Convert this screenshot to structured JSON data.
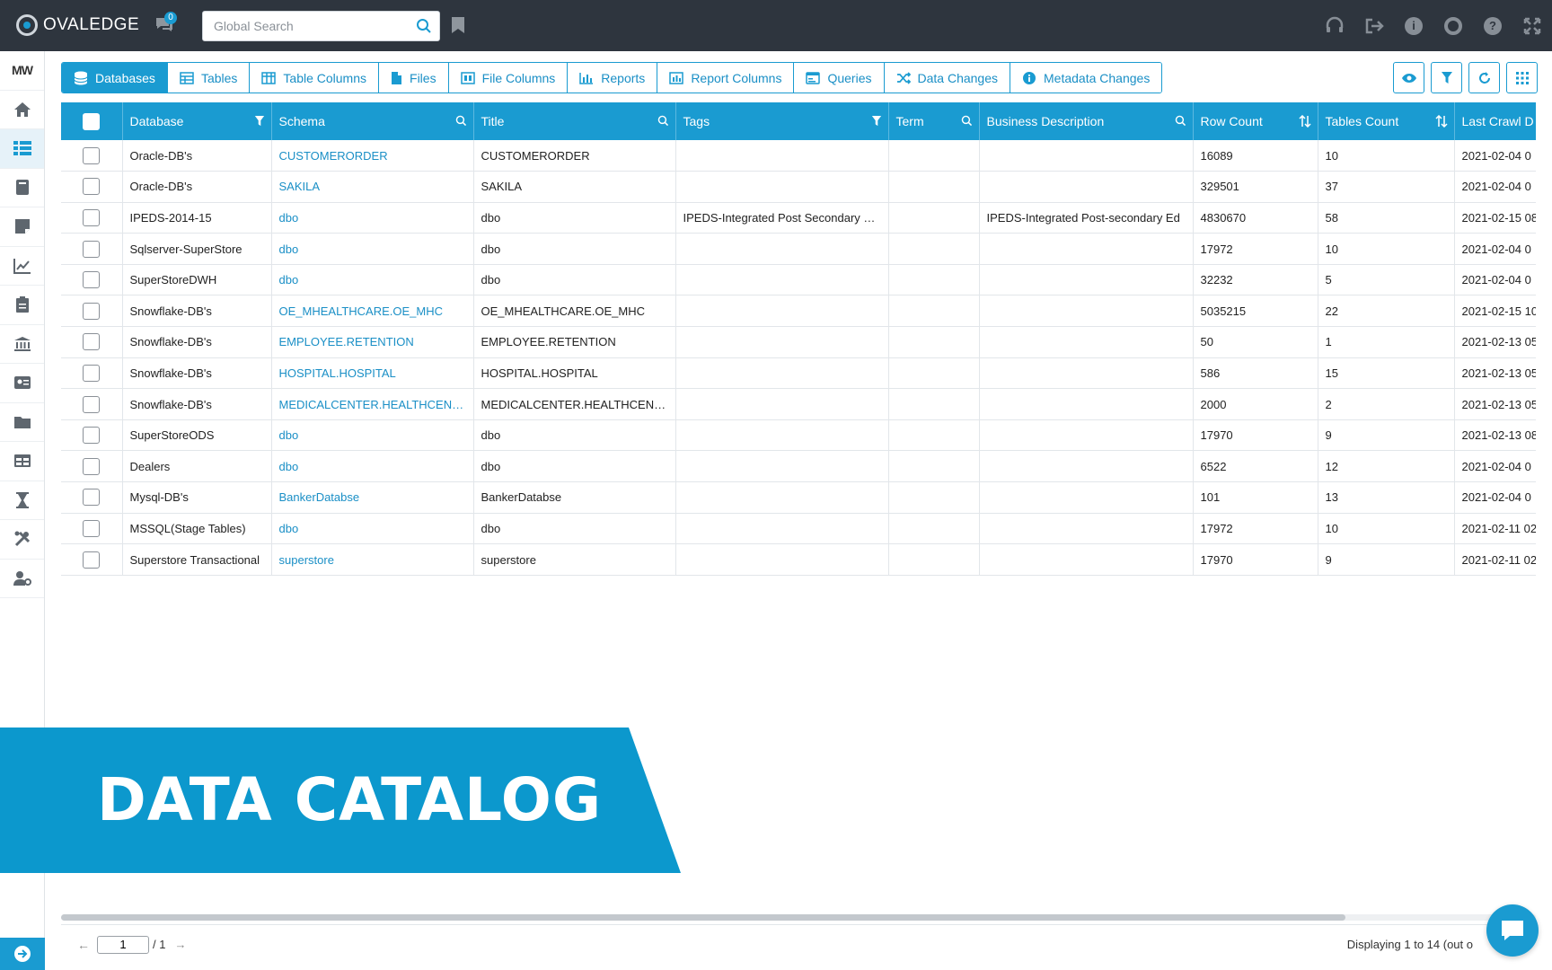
{
  "app": {
    "brand": "OVALEDGE",
    "chat_badge": "0"
  },
  "search": {
    "placeholder": "Global Search"
  },
  "sidebar": {
    "user_initials": "MW"
  },
  "tabs": [
    {
      "label": "Databases",
      "icon": "database-icon",
      "active": true
    },
    {
      "label": "Tables",
      "icon": "table-icon"
    },
    {
      "label": "Table Columns",
      "icon": "table-columns-icon"
    },
    {
      "label": "Files",
      "icon": "file-icon"
    },
    {
      "label": "File Columns",
      "icon": "file-columns-icon"
    },
    {
      "label": "Reports",
      "icon": "bar-chart-icon"
    },
    {
      "label": "Report Columns",
      "icon": "report-columns-icon"
    },
    {
      "label": "Queries",
      "icon": "query-icon"
    },
    {
      "label": "Data Changes",
      "icon": "shuffle-icon"
    },
    {
      "label": "Metadata Changes",
      "icon": "info-icon"
    }
  ],
  "table": {
    "columns": [
      "Database",
      "Schema",
      "Title",
      "Tags",
      "Term",
      "Business Description",
      "Row Count",
      "Tables Count",
      "Last Crawl D"
    ],
    "rows": [
      [
        "Oracle-DB's",
        "CUSTOMERORDER",
        "CUSTOMERORDER",
        "",
        "",
        "",
        "16089",
        "10",
        "2021-02-04 0"
      ],
      [
        "Oracle-DB's",
        "SAKILA",
        "SAKILA",
        "",
        "",
        "",
        "329501",
        "37",
        "2021-02-04 0"
      ],
      [
        "IPEDS-2014-15",
        "dbo",
        "dbo",
        "IPEDS-Integrated Post Secondary E...",
        "",
        "IPEDS-Integrated Post-secondary Ed",
        "4830670",
        "58",
        "2021-02-15 08"
      ],
      [
        "Sqlserver-SuperStore",
        "dbo",
        "dbo",
        "",
        "",
        "",
        "17972",
        "10",
        "2021-02-04 0"
      ],
      [
        "SuperStoreDWH",
        "dbo",
        "dbo",
        "",
        "",
        "",
        "32232",
        "5",
        "2021-02-04 0"
      ],
      [
        "Snowflake-DB's",
        "OE_MHEALTHCARE.OE_MHC",
        "OE_MHEALTHCARE.OE_MHC",
        "",
        "",
        "",
        "5035215",
        "22",
        "2021-02-15 10"
      ],
      [
        "Snowflake-DB's",
        "EMPLOYEE.RETENTION",
        "EMPLOYEE.RETENTION",
        "",
        "",
        "",
        "50",
        "1",
        "2021-02-13 05"
      ],
      [
        "Snowflake-DB's",
        "HOSPITAL.HOSPITAL",
        "HOSPITAL.HOSPITAL",
        "",
        "",
        "",
        "586",
        "15",
        "2021-02-13 05"
      ],
      [
        "Snowflake-DB's",
        "MEDICALCENTER.HEALTHCENTER",
        "MEDICALCENTER.HEALTHCENTER",
        "",
        "",
        "",
        "2000",
        "2",
        "2021-02-13 05"
      ],
      [
        "SuperStoreODS",
        "dbo",
        "dbo",
        "",
        "",
        "",
        "17970",
        "9",
        "2021-02-13 08"
      ],
      [
        "Dealers",
        "dbo",
        "dbo",
        "",
        "",
        "",
        "6522",
        "12",
        "2021-02-04 0"
      ],
      [
        "Mysql-DB's",
        "BankerDatabse",
        "BankerDatabse",
        "",
        "",
        "",
        "101",
        "13",
        "2021-02-04 0"
      ],
      [
        "MSSQL(Stage Tables)",
        "dbo",
        "dbo",
        "",
        "",
        "",
        "17972",
        "10",
        "2021-02-11 02"
      ],
      [
        "Superstore Transactional",
        "superstore",
        "superstore",
        "",
        "",
        "",
        "17970",
        "9",
        "2021-02-11 02"
      ]
    ]
  },
  "banner": {
    "text": "DATA CATALOG"
  },
  "pager": {
    "page": "1",
    "total": "/ 1",
    "display": "Displaying 1 to 14 (out o"
  },
  "colors": {
    "accent": "#1a9bd1",
    "topbar": "#2e353e"
  }
}
